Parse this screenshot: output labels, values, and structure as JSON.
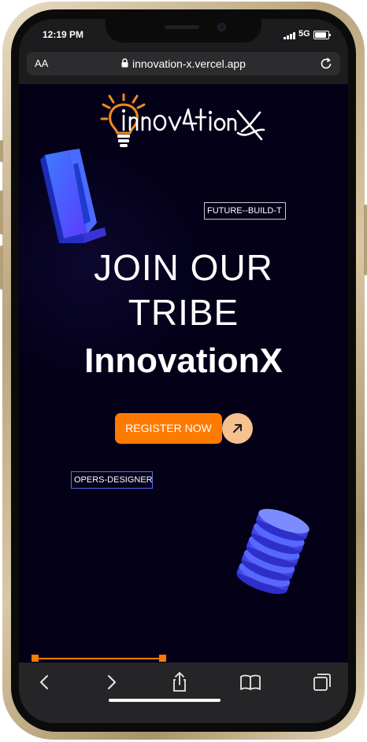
{
  "status_bar": {
    "time": "12:19 PM",
    "network": "5G"
  },
  "browser": {
    "text_size_label": "AA",
    "url": "innovation-x.vercel.app",
    "toolbar": {
      "back_icon": "chevron-left-icon",
      "forward_icon": "chevron-right-icon",
      "share_icon": "share-icon",
      "bookmarks_icon": "book-icon",
      "tabs_icon": "tabs-icon"
    }
  },
  "site": {
    "logo_text": "innovation X",
    "marquee_top": "FUTURE--BUILD-T",
    "marquee_bottom": "OPERS-DESIGNERS",
    "heading_line1": "JOIN OUR",
    "heading_line2": "TRIBE",
    "heading_brand": "InnovationX",
    "register_label": "REGISTER NOW",
    "arrow_icon": "arrow-up-right-icon"
  },
  "colors": {
    "page_background": "#030018",
    "accent_orange": "#ff7a00",
    "arrow_button": "#f6c08f",
    "object_blue": "#4b5cff"
  }
}
